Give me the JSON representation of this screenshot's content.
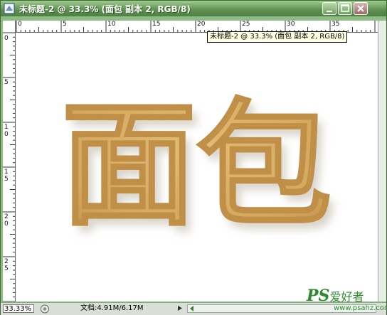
{
  "window": {
    "title": "未标题-2 @ 33.3% (面包 副本 2, RGB/8)",
    "tooltip": "未标题-2 @ 33.3% (面包 副本 2, RGB/8)"
  },
  "ruler_top": [
    "0",
    "5",
    "10",
    "15",
    "20",
    "25",
    "30",
    "35"
  ],
  "ruler_left": [
    "0",
    "5",
    "10",
    "15",
    "20",
    "25"
  ],
  "canvas": {
    "text": "面包",
    "fill_color": "#d9a85a",
    "shadow_color": "#b9b0a0"
  },
  "status": {
    "zoom": "33.33%",
    "doc_info": "文档:4.91M/6.17M"
  },
  "watermark": {
    "logo_ps": "PS",
    "logo_text": "爱好者",
    "url": "www.psahz.com"
  }
}
